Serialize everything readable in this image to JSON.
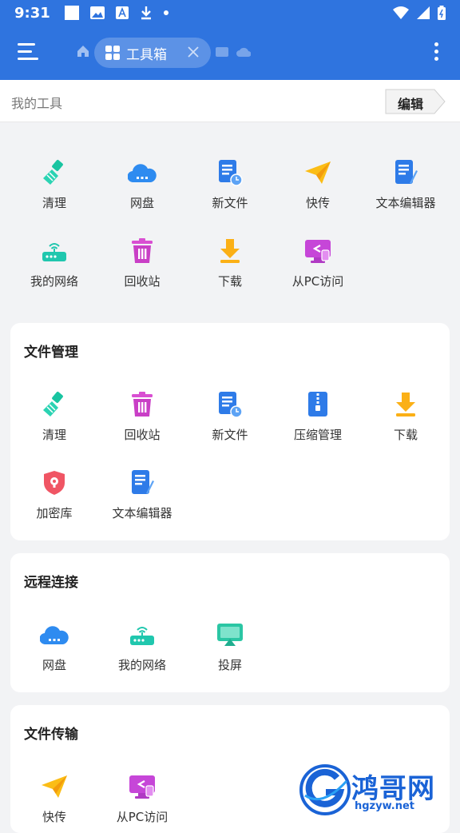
{
  "status_bar": {
    "time": "9:31"
  },
  "app_bar": {
    "tab_label": "工具箱",
    "icons": [
      "menu-icon",
      "home-icon",
      "grid-icon",
      "close-icon",
      "more-vertical-icon"
    ]
  },
  "my_tools": {
    "title": "我的工具",
    "edit_label": "编辑",
    "items": [
      {
        "label": "清理",
        "icon": "broom-icon"
      },
      {
        "label": "网盘",
        "icon": "cloud-icon"
      },
      {
        "label": "新文件",
        "icon": "new-file-icon"
      },
      {
        "label": "快传",
        "icon": "paper-plane-icon"
      },
      {
        "label": "文本编辑器",
        "icon": "text-editor-icon"
      },
      {
        "label": "我的网络",
        "icon": "router-icon"
      },
      {
        "label": "回收站",
        "icon": "trash-icon"
      },
      {
        "label": "下载",
        "icon": "download-icon"
      },
      {
        "label": "从PC访问",
        "icon": "pc-access-icon"
      }
    ]
  },
  "file_management": {
    "title": "文件管理",
    "items": [
      {
        "label": "清理",
        "icon": "broom-icon"
      },
      {
        "label": "回收站",
        "icon": "trash-icon"
      },
      {
        "label": "新文件",
        "icon": "new-file-icon"
      },
      {
        "label": "压缩管理",
        "icon": "zip-icon"
      },
      {
        "label": "下载",
        "icon": "download-icon"
      },
      {
        "label": "加密库",
        "icon": "vault-icon"
      },
      {
        "label": "文本编辑器",
        "icon": "text-editor-icon"
      }
    ]
  },
  "remote": {
    "title": "远程连接",
    "items": [
      {
        "label": "网盘",
        "icon": "cloud-icon"
      },
      {
        "label": "我的网络",
        "icon": "router-icon"
      },
      {
        "label": "投屏",
        "icon": "cast-icon"
      }
    ]
  },
  "transfer": {
    "title": "文件传输",
    "items": [
      {
        "label": "快传",
        "icon": "paper-plane-icon"
      },
      {
        "label": "从PC访问",
        "icon": "pc-access-icon"
      }
    ]
  },
  "watermark": {
    "text": "鸿哥网",
    "url": "hgzyw.net"
  },
  "colors": {
    "primary": "#2f74df",
    "background": "#f2f3f5",
    "card": "#ffffff"
  }
}
